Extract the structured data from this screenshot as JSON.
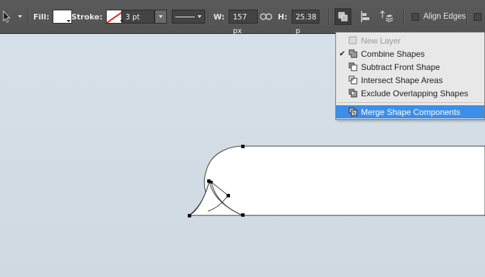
{
  "toolbar": {
    "fill_label": "Fill:",
    "stroke_label": "Stroke:",
    "stroke_width": "3 pt",
    "w_label": "W:",
    "w_value": "157 px",
    "h_label": "H:",
    "h_value": "25.38 p",
    "align_edges_label": "Align Edges",
    "align_edges_checked": false
  },
  "path_ops_menu": {
    "items": [
      {
        "label": "New Layer",
        "disabled": true,
        "checked": false,
        "icon": "new-layer-icon"
      },
      {
        "label": "Combine Shapes",
        "disabled": false,
        "checked": true,
        "icon": "combine-shapes-icon"
      },
      {
        "label": "Subtract Front Shape",
        "disabled": false,
        "checked": false,
        "icon": "subtract-front-shape-icon"
      },
      {
        "label": "Intersect Shape Areas",
        "disabled": false,
        "checked": false,
        "icon": "intersect-shape-areas-icon"
      },
      {
        "label": "Exclude Overlapping Shapes",
        "disabled": false,
        "checked": false,
        "icon": "exclude-overlapping-shapes-icon"
      },
      {
        "label": "Merge Shape Components",
        "disabled": false,
        "checked": false,
        "highlighted": true,
        "icon": "merge-shape-components-icon"
      }
    ],
    "check_glyph": "✔"
  },
  "colors": {
    "toolbar_bg": "#535353",
    "canvas_bg": "#d4dee6",
    "menu_bg": "#e8e8e8",
    "menu_highlight": "#3c8ee8",
    "stroke_none_red": "#e02020"
  }
}
